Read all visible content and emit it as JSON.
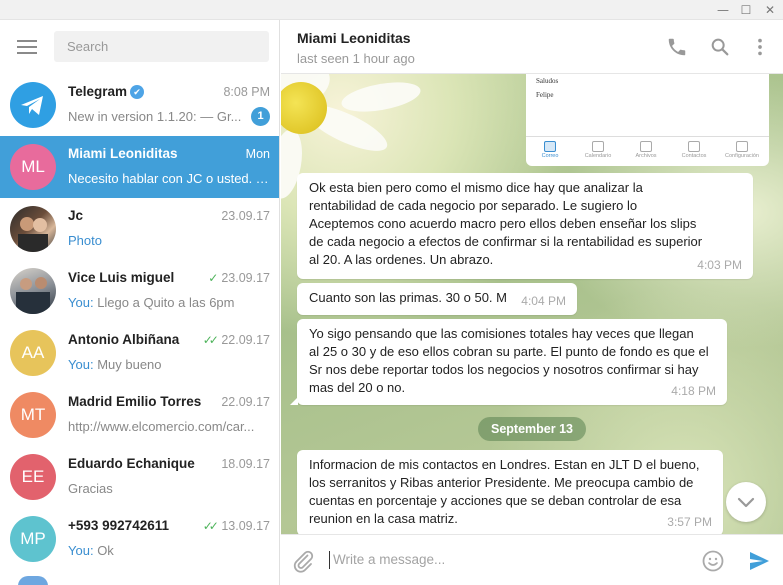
{
  "window": {
    "minimize": "—",
    "maximize": "☐",
    "close": "✕"
  },
  "search": {
    "placeholder": "Search"
  },
  "chats": [
    {
      "name": "Telegram",
      "verified": true,
      "time": "8:08 PM",
      "preview": "New in version 1.1.20: — Gr...",
      "badge": "1",
      "avatar_initials": "",
      "avatar_color": "#2f9fe3"
    },
    {
      "name": "Miami Leoniditas",
      "time": "Mon",
      "preview": "Necesito hablar con JC o usted. T...",
      "avatar_initials": "ML",
      "avatar_color": "#e86b9c"
    },
    {
      "name": "Jc",
      "time": "23.09.17",
      "preview": "Photo",
      "preview_highlight": true,
      "avatar_initials": "",
      "avatar_color": "#6b4d3a"
    },
    {
      "name": "Vice Luis miguel",
      "time": "23.09.17",
      "read": "single",
      "sender": "You:",
      "preview": "Llego a Quito a las 6pm",
      "avatar_initials": "",
      "avatar_color": "#47525e"
    },
    {
      "name": "Antonio Albiñana",
      "time": "22.09.17",
      "read": "double",
      "sender": "You:",
      "preview": "Muy bueno",
      "avatar_initials": "AA",
      "avatar_color": "#e7c45b"
    },
    {
      "name": "Madrid Emilio Torres",
      "time": "22.09.17",
      "preview": "http://www.elcomercio.com/car...",
      "avatar_initials": "MT",
      "avatar_color": "#ef8a63"
    },
    {
      "name": "Eduardo Echanique",
      "time": "18.09.17",
      "preview": "Gracias",
      "avatar_initials": "EE",
      "avatar_color": "#e2626d"
    },
    {
      "name": "+593 992742611",
      "time": "13.09.17",
      "read": "double",
      "sender": "You:",
      "preview": "Ok",
      "avatar_initials": "MP",
      "avatar_color": "#5ec3cf"
    }
  ],
  "conversation": {
    "title": "Miami Leoniditas",
    "status": "last seen 1 hour ago",
    "image_message": {
      "lines": [
        "Saludos",
        "Felipe"
      ],
      "tabs": [
        "Correo",
        "Calendario",
        "Archivos",
        "Contactos",
        "Configuración"
      ]
    },
    "messages": [
      {
        "text": "Ok esta bien pero como el mismo dice hay que analizar la\nrentabilidad de cada negocio por separado. Le sugiero lo\nAceptemos  cono acuerdo macro pero ellos deben enseñar los slips\nde cada negocio a efectos de confirmar si la rentabilidad es superior\nal 20.  A las ordenes. Un abrazo.",
        "time": "4:03 PM"
      },
      {
        "text": "Cuanto son las primas. 30 o 50. M",
        "time": "4:04 PM"
      },
      {
        "text": "Yo sigo pensando que las comisiones  totales hay veces que llegan\nal 25 o 30 y de eso ellos cobran su parte. El punto de fondo es que el\nSr nos debe reportar todos los negocios y nosotros confirmar si hay\nmas del 20 o no.",
        "time": "4:18 PM"
      },
      {
        "text": "Informacion de mis contactos en Londres. Estan en JLT D el bueno,\nlos serranitos y Ribas anterior Presidente. Me preocupa cambio de\ncuentas en porcentaje y acciones que se deban controlar de esa\nreunion en la casa matriz.",
        "time": "3:57 PM"
      }
    ],
    "date_separator": "September 13"
  },
  "composer": {
    "placeholder": "Write a message..."
  },
  "colors": {
    "accent": "#419fd9",
    "read_check": "#4db35a",
    "you_label": "#3a8ed0"
  }
}
